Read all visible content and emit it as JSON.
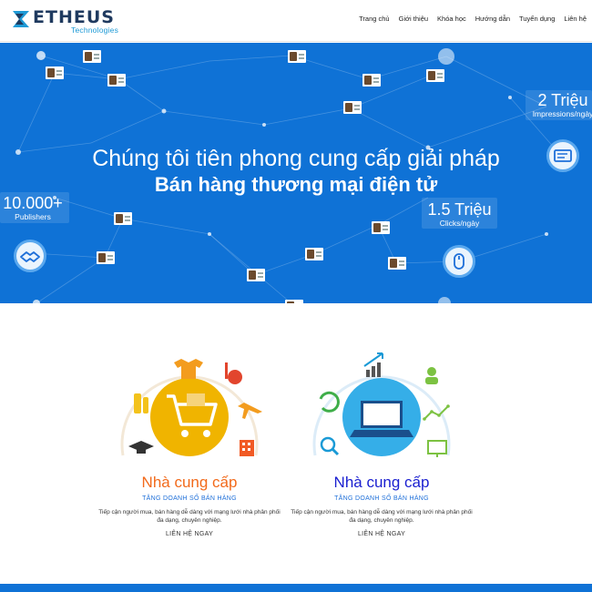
{
  "brand": {
    "name": "ETHEUS",
    "tagline": "Technologies",
    "color_primary": "#1f3a5f",
    "color_accent": "#1e9ad6"
  },
  "nav": {
    "items": [
      "Trang chủ",
      "Giới thiệu",
      "Khóa học",
      "Hướng dẫn",
      "Tuyển dụng",
      "Liên hệ"
    ]
  },
  "hero": {
    "background": "#0f72d6",
    "line1": "Chúng tôi tiên phong cung cấp giải pháp",
    "line2": "Bán hàng thương mại điện tử",
    "stats": {
      "impressions": {
        "value": "2 Triệu",
        "label": "Impressions/ngày"
      },
      "publishers": {
        "value": "10.000+",
        "label": "Publishers"
      },
      "clicks": {
        "value": "1.5 Triệu",
        "label": "Clicks/ngày"
      }
    },
    "icons": [
      "handshake-icon",
      "mouse-icon",
      "id-card-icon"
    ]
  },
  "suppliers": [
    {
      "title": "Nhà cung cấp",
      "title_color": "#f26a1b",
      "subtitle": "TĂNG DOANH SỐ BÁN HÀNG",
      "description": "Tiếp cận người mua, bán hàng dễ dàng với mạng lưới nhà phân phối đa dạng, chuyên nghiệp.",
      "link": "LIÊN HỆ NGAY",
      "center_icon": "shopping-cart-icon"
    },
    {
      "title": "Nhà cung cấp",
      "title_color": "#1a1fd0",
      "subtitle": "TĂNG DOANH SỐ BÁN HÀNG",
      "description": "Tiếp cận người mua, bán hàng dễ dàng với mạng lưới nhà phân phối đa dạng, chuyên nghiệp.",
      "link": "LIÊN HỆ NGAY",
      "center_icon": "laptop-icon"
    }
  ]
}
